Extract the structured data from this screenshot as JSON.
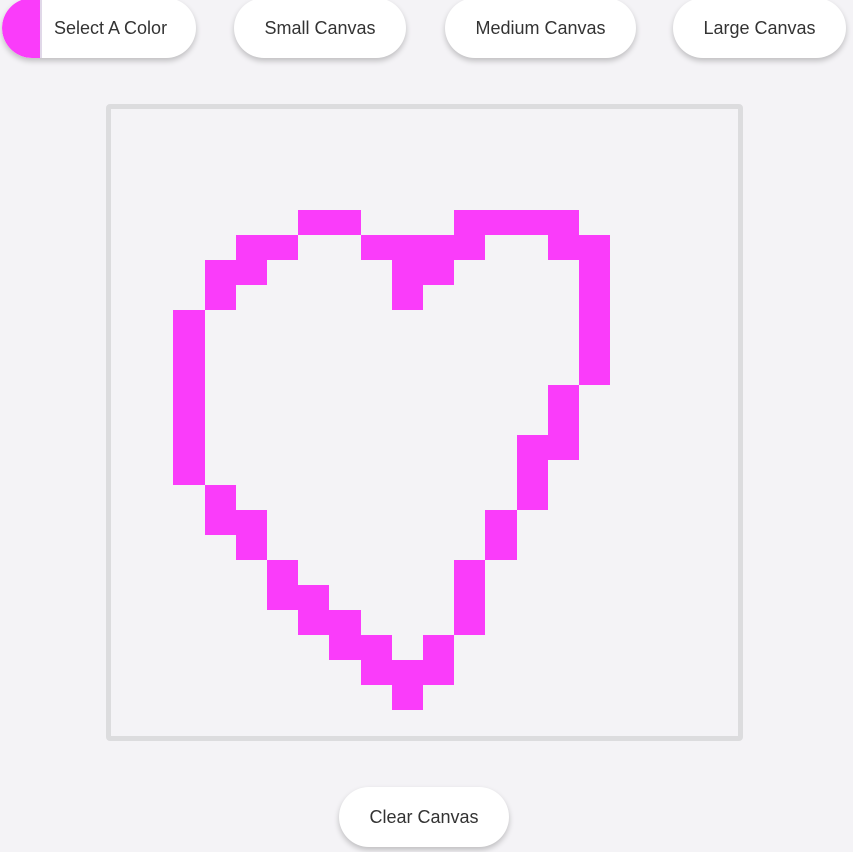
{
  "toolbar": {
    "select_color_label": "Select A Color",
    "small_canvas_label": "Small Canvas",
    "medium_canvas_label": "Medium Canvas",
    "large_canvas_label": "Large Canvas"
  },
  "footer": {
    "clear_canvas_label": "Clear Canvas"
  },
  "colors": {
    "selected": "#fa3cfa",
    "canvas_border": "#dcdcde",
    "background": "#f4f3f6"
  },
  "canvas": {
    "grid_size": 20,
    "painted_cells": [
      [
        6,
        3
      ],
      [
        7,
        3
      ],
      [
        11,
        3
      ],
      [
        12,
        3
      ],
      [
        13,
        3
      ],
      [
        14,
        3
      ],
      [
        4,
        4
      ],
      [
        5,
        4
      ],
      [
        8,
        4
      ],
      [
        9,
        4
      ],
      [
        10,
        4
      ],
      [
        11,
        4
      ],
      [
        14,
        4
      ],
      [
        15,
        4
      ],
      [
        3,
        5
      ],
      [
        4,
        5
      ],
      [
        9,
        5
      ],
      [
        10,
        5
      ],
      [
        15,
        5
      ],
      [
        3,
        6
      ],
      [
        9,
        6
      ],
      [
        15,
        6
      ],
      [
        2,
        7
      ],
      [
        15,
        7
      ],
      [
        2,
        8
      ],
      [
        15,
        8
      ],
      [
        2,
        9
      ],
      [
        15,
        9
      ],
      [
        2,
        10
      ],
      [
        14,
        10
      ],
      [
        2,
        11
      ],
      [
        14,
        11
      ],
      [
        2,
        12
      ],
      [
        13,
        12
      ],
      [
        14,
        12
      ],
      [
        2,
        13
      ],
      [
        13,
        13
      ],
      [
        3,
        14
      ],
      [
        13,
        14
      ],
      [
        3,
        15
      ],
      [
        4,
        15
      ],
      [
        12,
        15
      ],
      [
        4,
        16
      ],
      [
        12,
        16
      ],
      [
        5,
        17
      ],
      [
        11,
        17
      ],
      [
        5,
        18
      ],
      [
        6,
        18
      ],
      [
        11,
        18
      ],
      [
        6,
        19
      ],
      [
        7,
        19
      ],
      [
        11,
        19
      ],
      [
        7,
        20
      ],
      [
        8,
        20
      ],
      [
        10,
        20
      ],
      [
        8,
        21
      ],
      [
        9,
        21
      ],
      [
        10,
        21
      ],
      [
        9,
        22
      ]
    ]
  }
}
